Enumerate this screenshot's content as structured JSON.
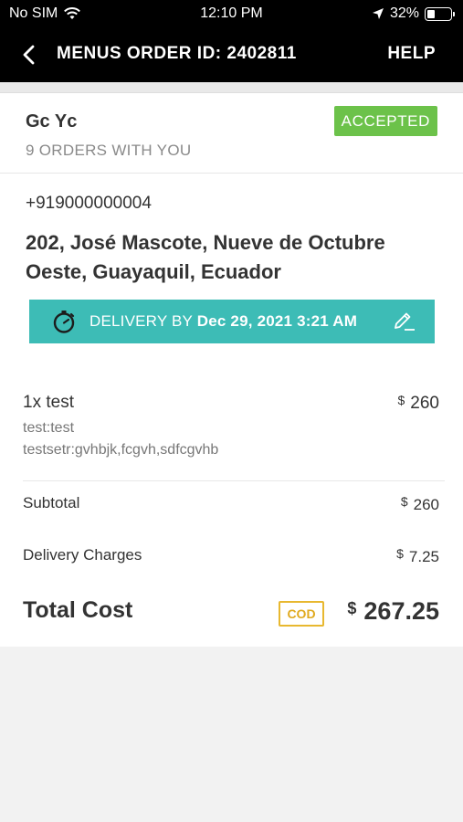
{
  "status_bar": {
    "carrier": "No SIM",
    "time": "12:10 PM",
    "battery": "32%",
    "wifi_icon": "wifi-icon",
    "location_icon": "location-arrow-icon",
    "battery_icon": "battery-icon",
    "battery_level": 0.32
  },
  "header": {
    "title": "MENUS ORDER ID: 2402811",
    "help_label": "HELP",
    "back_icon": "chevron-left-icon"
  },
  "customer": {
    "name": "Gc Yc",
    "orders_text": "9 ORDERS WITH YOU",
    "status": "ACCEPTED",
    "status_color": "#6cc24a"
  },
  "contact": {
    "phone": "+919000000004",
    "address": "202, José Mascote, Nueve de Octubre Oeste, Guayaquil, Ecuador"
  },
  "delivery": {
    "prefix": "DELIVERY BY",
    "datetime": "Dec 29, 2021 3:21 AM",
    "color": "#3dbcb6",
    "clock_icon": "stopwatch-icon",
    "edit_icon": "pencil-edit-icon"
  },
  "items": [
    {
      "name": "1x test",
      "currency": "$",
      "price": "260",
      "options": [
        "test:test",
        "testsetr:gvhbjk,fcgvh,sdfcgvhb"
      ]
    }
  ],
  "summary": {
    "subtotal_label": "Subtotal",
    "subtotal_currency": "$",
    "subtotal_value": "260",
    "delivery_label": "Delivery Charges",
    "delivery_currency": "$",
    "delivery_value": "7.25",
    "total_label": "Total Cost",
    "payment_badge": "COD",
    "total_currency": "$",
    "total_value": "267.25"
  }
}
